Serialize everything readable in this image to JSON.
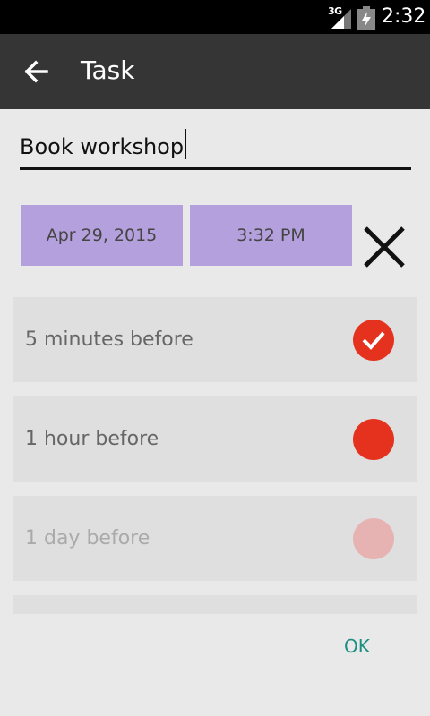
{
  "status_bar": {
    "network": "3G",
    "time": "2:32"
  },
  "app_bar": {
    "title": "Task"
  },
  "task": {
    "name": "Book workshop"
  },
  "schedule": {
    "date": "Apr 29, 2015",
    "time": "3:32 PM"
  },
  "reminders": [
    {
      "label": "5 minutes before",
      "state": "checked"
    },
    {
      "label": "1 hour before",
      "state": "unchecked"
    },
    {
      "label": "1 day before",
      "state": "disabled"
    }
  ],
  "actions": {
    "ok": "OK"
  },
  "colors": {
    "accent": "#e5321f",
    "picker": "#b3a0dc",
    "ok": "#1e8e83",
    "toolbar": "#353535"
  }
}
